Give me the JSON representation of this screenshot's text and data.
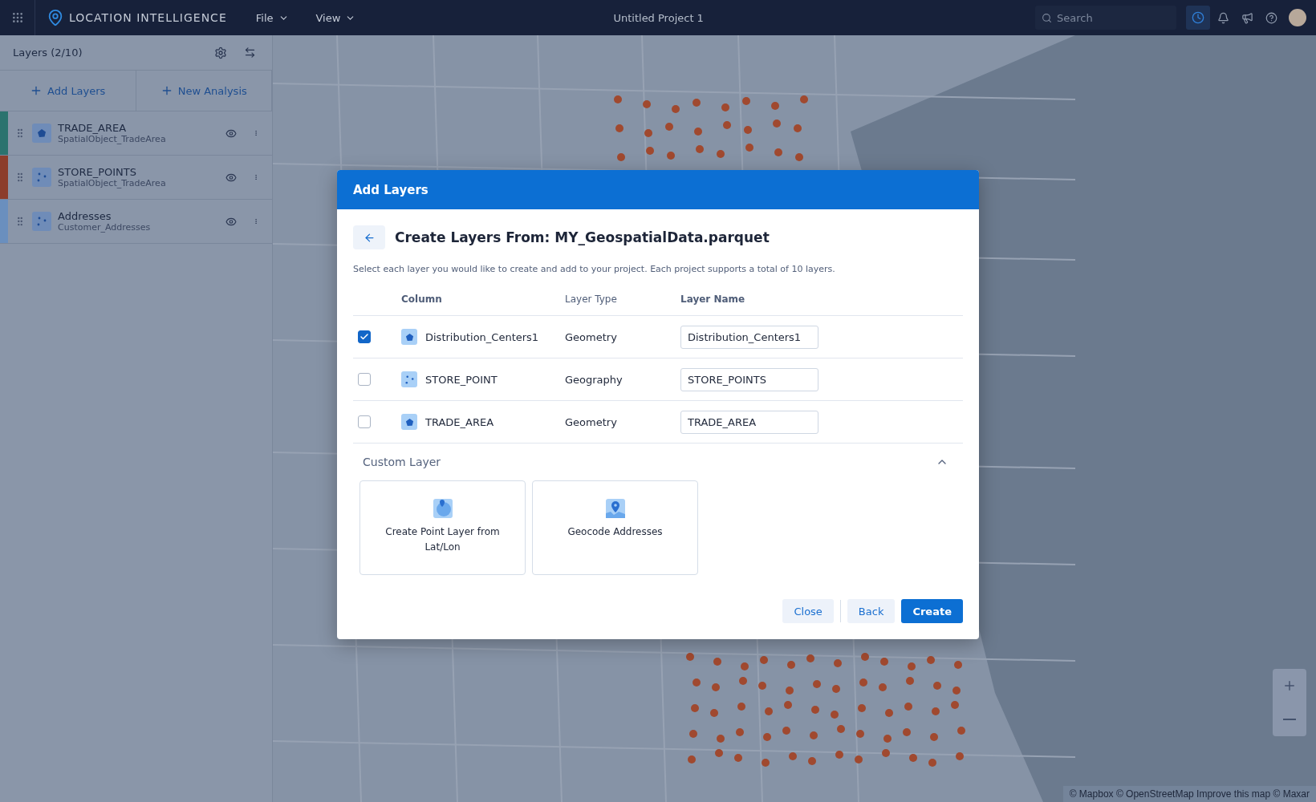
{
  "app": {
    "title": "LOCATION INTELLIGENCE",
    "menus": [
      {
        "label": "File"
      },
      {
        "label": "View"
      }
    ],
    "project": "Untitled Project 1",
    "search": {
      "placeholder": "Search"
    },
    "history_active": true
  },
  "sidebar": {
    "title": "Layers (2/10)",
    "actions": [
      {
        "label": "Add Layers"
      },
      {
        "label": "New Analysis"
      }
    ],
    "layers": [
      {
        "name": "TRADE_AREA",
        "source": "SpatialObject_TradeArea",
        "kind": "polygon",
        "color": "#2b736e"
      },
      {
        "name": "STORE_POINTS",
        "source": "SpatialObject_TradeArea",
        "kind": "points",
        "color": "#8c3d2b"
      },
      {
        "name": "Addresses",
        "source": "Customer_Addresses",
        "kind": "points",
        "color": "#6a8fbe"
      }
    ]
  },
  "map": {
    "attribution": "© Mapbox © OpenStreetMap Improve this map © Maxar"
  },
  "dialog": {
    "title": "Add Layers",
    "heading": "Create Layers From: MY_GeospatialData.parquet",
    "description": "Select each layer you would like to create and add to your project. Each project supports a total of 10 layers.",
    "columns": [
      "Column",
      "Layer Type",
      "Layer Name"
    ],
    "rows": [
      {
        "checked": true,
        "column": "Distribution_Centers1",
        "kind": "polygon",
        "layer_type": "Geometry",
        "layer_name": "Distribution_Centers1"
      },
      {
        "checked": false,
        "column": "STORE_POINT",
        "kind": "points",
        "layer_type": "Geography",
        "layer_name": "STORE_POINTS"
      },
      {
        "checked": false,
        "column": "TRADE_AREA",
        "kind": "polygon",
        "layer_type": "Geometry",
        "layer_name": "TRADE_AREA"
      }
    ],
    "custom": {
      "title": "Custom Layer",
      "expanded": true,
      "options": [
        {
          "label": "Create Point Layer from Lat/Lon",
          "kind": "globe"
        },
        {
          "label": "Geocode Addresses",
          "kind": "pin"
        }
      ]
    },
    "buttons": [
      {
        "label": "Close",
        "kind": "secondary"
      },
      {
        "label": "Back",
        "kind": "secondary"
      },
      {
        "label": "Create",
        "kind": "primary"
      }
    ]
  }
}
